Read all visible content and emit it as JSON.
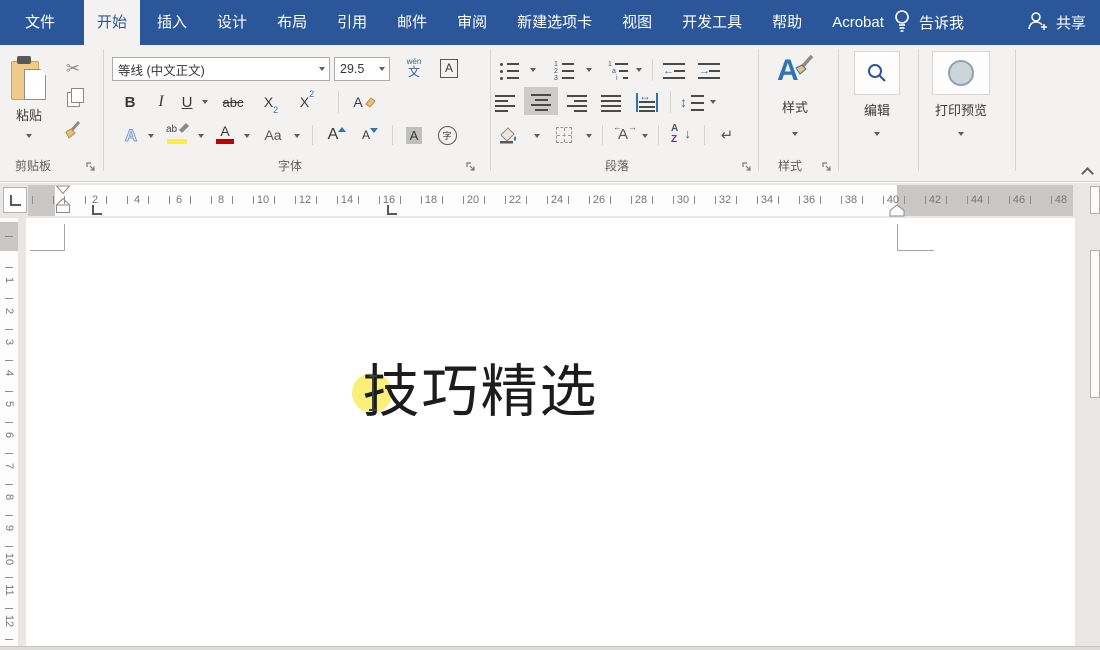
{
  "tabbar": {
    "tabs": [
      {
        "label": "文件"
      },
      {
        "label": "开始",
        "active": true
      },
      {
        "label": "插入"
      },
      {
        "label": "设计"
      },
      {
        "label": "布局"
      },
      {
        "label": "引用"
      },
      {
        "label": "邮件"
      },
      {
        "label": "审阅"
      },
      {
        "label": "新建选项卡"
      },
      {
        "label": "视图"
      },
      {
        "label": "开发工具"
      },
      {
        "label": "帮助"
      },
      {
        "label": "Acrobat"
      }
    ],
    "tell_me": "告诉我",
    "share": "共享"
  },
  "ribbon": {
    "clipboard": {
      "paste_label": "粘贴",
      "group_label": "剪贴板"
    },
    "font": {
      "name_value": "等线 (中文正文)",
      "size_value": "29.5",
      "phonetic_top": "wén",
      "phonetic_bottom": "文",
      "char_border": "A",
      "bold": "B",
      "italic": "I",
      "underline": "U",
      "strikethrough": "abc",
      "sub_base": "X",
      "sub_num": "2",
      "sup_base": "X",
      "sup_num": "2",
      "clear_format": "A",
      "text_effects": "A",
      "highlight": "ab",
      "font_color": "A",
      "change_case": "Aa",
      "grow": "A",
      "shrink": "A",
      "char_shading": "A",
      "enclose": "字",
      "group_label": "字体"
    },
    "paragraph": {
      "num1": "1",
      "num2": "2",
      "num3": "3",
      "ml1": "1",
      "ml2": "a",
      "ml3": "i",
      "asian": "A",
      "sort_top": "A",
      "sort_bottom": "Z",
      "group_label": "段落"
    },
    "styles": {
      "icon_letter": "A",
      "button_label": "样式",
      "group_label": "样式"
    },
    "editing": {
      "button_label": "编辑"
    },
    "print_preview": {
      "button_label": "打印预览"
    }
  },
  "glyphs": {
    "cut": "✂",
    "show_mark": "↵",
    "line_spacing": "↕",
    "distribute": "↔",
    "outdent": "←",
    "indent": "→",
    "asian_left": "←",
    "asian_right": "→",
    "sort_arrow": "↓"
  },
  "ruler": {
    "tab_selector": "L",
    "h_numbers": [
      2,
      4,
      6,
      8,
      10,
      12,
      14,
      16,
      18,
      20,
      22,
      24,
      26,
      28,
      30,
      32,
      34,
      36,
      38,
      40,
      42,
      44,
      46,
      48
    ],
    "v_numbers": [
      1,
      2,
      3,
      4,
      5,
      6,
      7,
      8,
      9,
      10,
      11,
      12
    ]
  },
  "document": {
    "heading": "技巧精选"
  },
  "colors": {
    "accent_blue": "#2b579a",
    "ribbon_bg": "#f3f2f1",
    "highlight_yellow": "#ffed3d",
    "font_color_red": "#c00000",
    "click_ring_yellow": "rgba(247,233,69,0.72)"
  }
}
